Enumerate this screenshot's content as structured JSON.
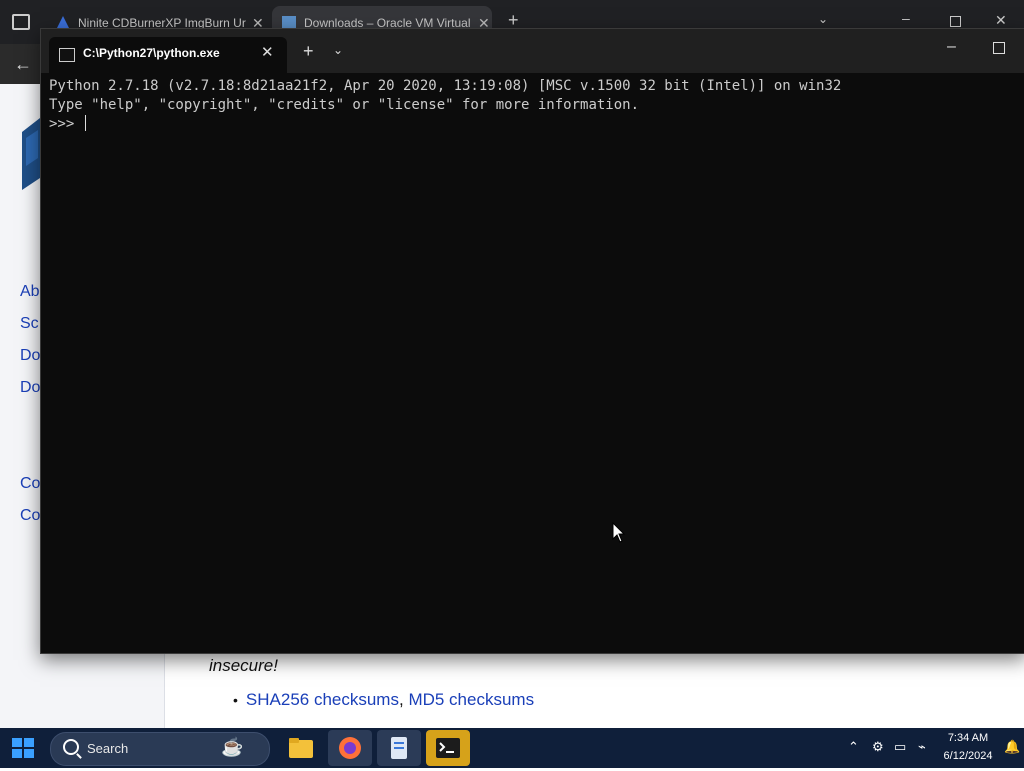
{
  "browser": {
    "tabs": [
      {
        "label": "Ninite CDBurnerXP ImgBurn Ur"
      },
      {
        "label": "Downloads – Oracle VM Virtual"
      }
    ],
    "new_tab_label": "+",
    "sidebar_links": [
      "Ab",
      "Sc",
      "Do",
      "Do",
      "Co",
      "Co"
    ],
    "content": {
      "insecure_text": "insecure!",
      "checksums_sha": "SHA256 checksums",
      "checksums_sep": ", ",
      "checksums_md5": "MD5 checksums"
    }
  },
  "terminal": {
    "tab_title": "C:\\Python27\\python.exe",
    "lines": [
      "Python 2.7.18 (v2.7.18:8d21aa21f2, Apr 20 2020, 13:19:08) [MSC v.1500 32 bit (Intel)] on win32",
      "Type \"help\", \"copyright\", \"credits\" or \"license\" for more information."
    ],
    "prompt": ">>> "
  },
  "taskbar": {
    "search_label": "Search",
    "apps": [
      "file-explorer",
      "firefox",
      "notepad",
      "terminal"
    ],
    "clock_time": "7:34 AM",
    "clock_date": "6/12/2024"
  },
  "colors": {
    "terminal_bg": "#0c0c0c",
    "taskbar_bg": "#0f1f3a",
    "link": "#1a3fb8"
  }
}
